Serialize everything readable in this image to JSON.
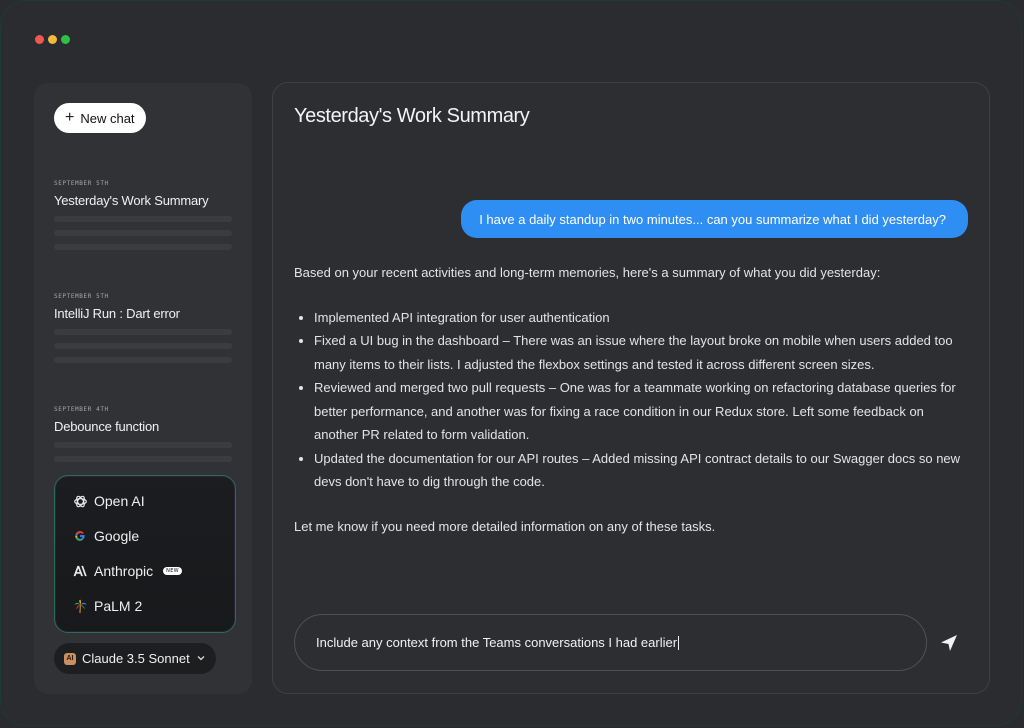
{
  "sidebar": {
    "new_chat_label": "New chat",
    "chats": [
      {
        "date": "September 5th",
        "title": "Yesterday's Work Summary"
      },
      {
        "date": "September 5th",
        "title": "IntelliJ Run : Dart error"
      },
      {
        "date": "September 4th",
        "title": "Debounce function"
      }
    ],
    "providers": [
      {
        "label": "Open AI",
        "icon": "openai-icon"
      },
      {
        "label": "Google",
        "icon": "google-icon"
      },
      {
        "label": "Anthropic",
        "icon": "anthropic-icon",
        "badge": "NEW"
      },
      {
        "label": "PaLM 2",
        "icon": "palm-icon"
      }
    ],
    "model_select": {
      "value": "Claude 3.5 Sonnet",
      "icon_text": "AI"
    }
  },
  "main": {
    "title": "Yesterday's Work Summary",
    "user_message": "I have a daily standup in two minutes... can you summarize what I did yesterday?",
    "answer_intro": "Based on your recent activities and long-term memories, here's a summary of what you did yesterday:",
    "answer_items": [
      " Implemented API integration for user authentication",
      " Fixed a UI bug in the dashboard – There was an issue where the layout broke on mobile when users added too many items to their lists. I adjusted the flexbox settings and tested it across different screen sizes.",
      "Reviewed and merged two pull requests – One was for a teammate working on refactoring database queries for better performance, and another was for fixing a race condition in our Redux store. Left some feedback on another PR related to form validation.",
      "Updated the documentation for our API routes – Added missing API contract details to our Swagger docs so new devs don't have to dig through the code."
    ],
    "answer_closing": "Let me know if you need more detailed information on any of these tasks.",
    "composer_value": "Include any context from the Teams conversations I had earlier"
  },
  "colors": {
    "accent": "#2f8ef4",
    "provider_border": "#2f6a55"
  }
}
